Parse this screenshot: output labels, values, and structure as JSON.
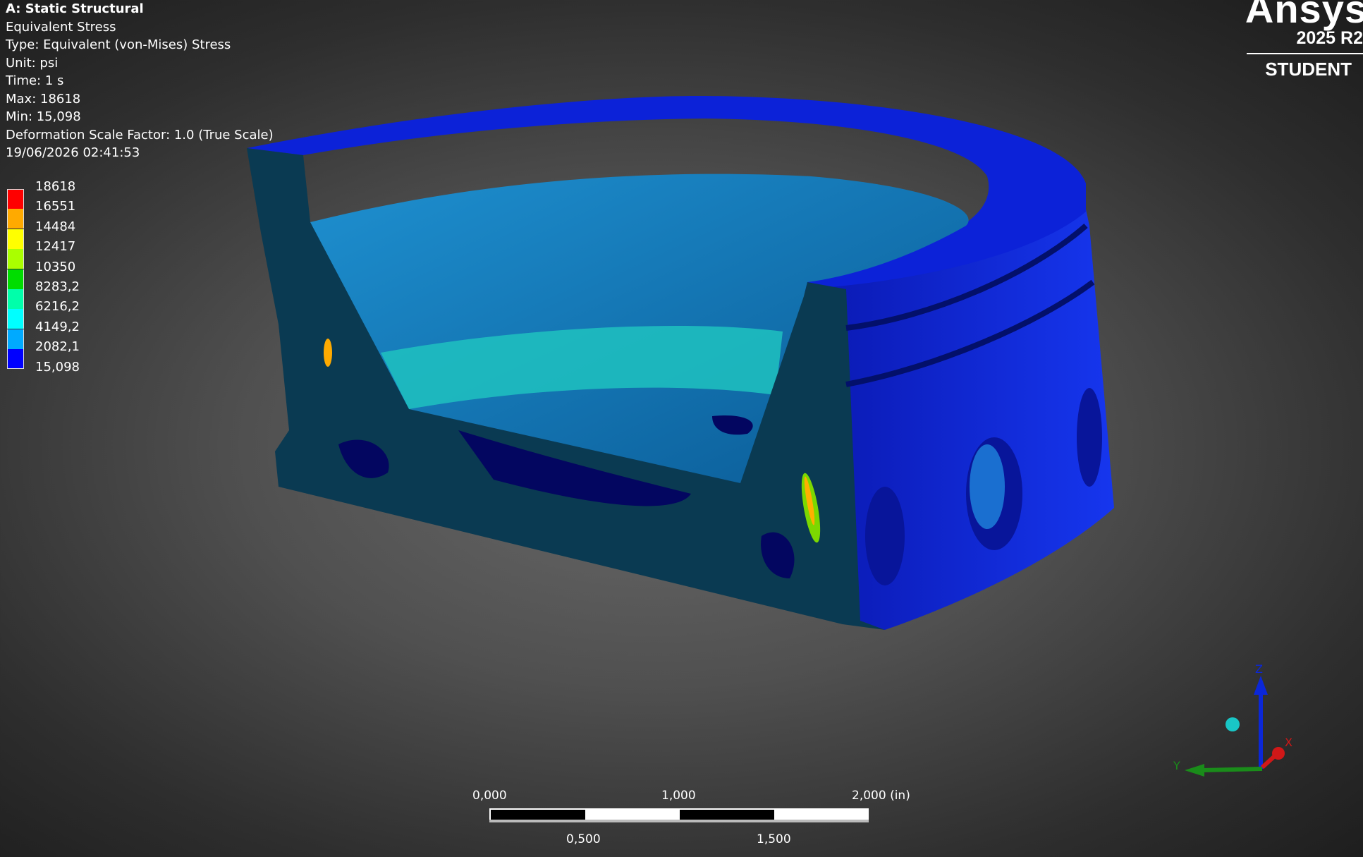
{
  "info": {
    "title": "A: Static Structural",
    "result": "Equivalent Stress",
    "type": "Type: Equivalent (von-Mises) Stress",
    "unit": "Unit: psi",
    "time": "Time: 1 s",
    "max": "Max: 18618",
    "min": "Min: 15,098",
    "scale": "Deformation Scale Factor: 1.0 (True Scale)",
    "timestamp": "19/06/2026 02:41:53"
  },
  "legend": [
    {
      "label": "18618",
      "color": "#ff0000"
    },
    {
      "label": "16551",
      "color": "#ffaa00"
    },
    {
      "label": "14484",
      "color": "#ffff00"
    },
    {
      "label": "12417",
      "color": "#aaff00"
    },
    {
      "label": "10350",
      "color": "#00dd00"
    },
    {
      "label": "8283,2",
      "color": "#00ffaa"
    },
    {
      "label": "6216,2",
      "color": "#00ffff"
    },
    {
      "label": "4149,2",
      "color": "#00aaff"
    },
    {
      "label": "2082,1",
      "color": "#0000ff"
    },
    {
      "label": "15,098",
      "color": ""
    }
  ],
  "logo": {
    "brand": "Ansys",
    "version": "2025 R2",
    "edition": "STUDENT"
  },
  "scalebar": {
    "top_labels": [
      "0,000",
      "1,000",
      "2,000 (in)"
    ],
    "bottom_labels": [
      "0,500",
      "1,500"
    ]
  },
  "triad": {
    "z": "Z",
    "x": "X",
    "y": "Y"
  }
}
